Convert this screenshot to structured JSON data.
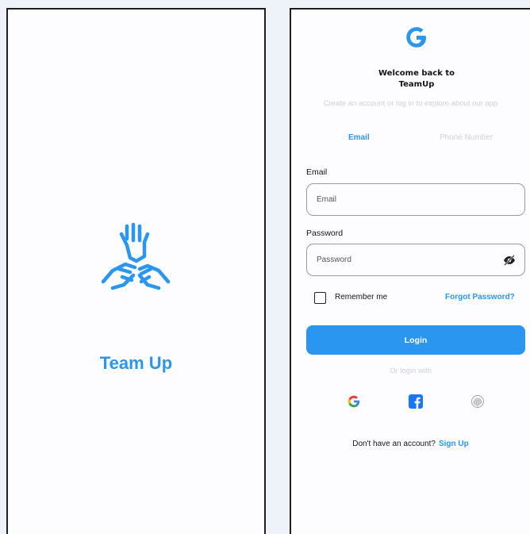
{
  "splash": {
    "logo_icon": "team-hands-icon",
    "app_name": "Team Up"
  },
  "login": {
    "logo_icon": "google-g-icon",
    "welcome_line1": "Welcome back to",
    "welcome_line2": "TeamUp",
    "subtitle": "Create an account or log in to explore about our app",
    "tabs": [
      {
        "label": "Email",
        "active": true
      },
      {
        "label": "Phone Number",
        "active": false
      }
    ],
    "email": {
      "label": "Email",
      "placeholder": "Email"
    },
    "password": {
      "label": "Password",
      "placeholder": "Password",
      "toggle_icon": "eye-off-icon"
    },
    "remember_label": "Remember me",
    "remember_checked": false,
    "forgot_label": "Forgot Password?",
    "login_label": "Login",
    "or_login_with": "Or login with",
    "social": [
      {
        "icon": "google-icon"
      },
      {
        "icon": "facebook-icon"
      },
      {
        "icon": "fingerprint-icon"
      }
    ],
    "signup_prompt": "Don't have an account?",
    "signup_label": "Sign Up"
  },
  "colors": {
    "accent": "#2b96ef",
    "muted": "#cfd2da",
    "text": "#141414"
  }
}
